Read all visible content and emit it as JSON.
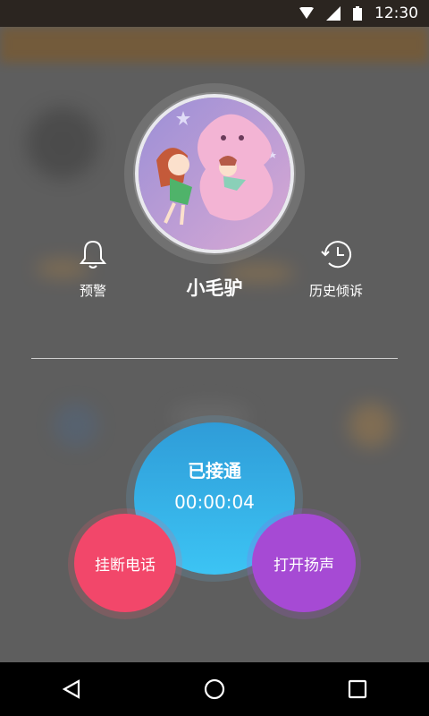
{
  "status_bar": {
    "time": "12:30",
    "icons": [
      "wifi-icon",
      "signal-icon",
      "battery-icon"
    ]
  },
  "contact": {
    "name": "小毛驴",
    "avatar": "cartoon girl with pink ghost illustration"
  },
  "actions": {
    "warning_label": "预警",
    "history_label": "历史倾诉"
  },
  "call": {
    "status": "已接通",
    "duration": "00:00:04",
    "hangup_label": "挂断电话",
    "speaker_label": "打开扬声"
  },
  "colors": {
    "status_blue": "#2f9cd8",
    "hangup_red": "#f2476a",
    "speaker_purple": "#a64ad4"
  },
  "nav": {
    "icons": [
      "back-icon",
      "home-icon",
      "recents-icon"
    ]
  }
}
